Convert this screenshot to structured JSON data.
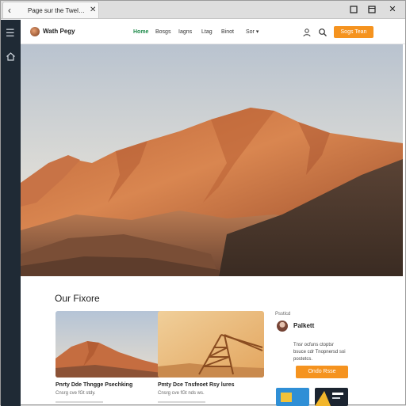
{
  "browser": {
    "tab_title": "Page sur the Twelaaon...",
    "back_icon": "back-arrow-icon",
    "close_icon": "close-icon",
    "controls": [
      "minimize-icon",
      "restore-icon",
      "close-icon"
    ]
  },
  "rail": {
    "menu_icon": "hamburger-menu-icon",
    "home_icon": "home-icon"
  },
  "header": {
    "brand": "Wath Pegy",
    "nav": [
      "Home",
      "Bosgs",
      "Iagns",
      "Ltag",
      "Binot",
      "Sor"
    ],
    "active_nav": "Home",
    "cta_label": "Sogs Tean"
  },
  "content": {
    "section_title": "Our Fixore",
    "cards": [
      {
        "title": "Pnrty Dde Thngge Psechking",
        "subtitle": "Cnsrg cve fGt stdy."
      },
      {
        "title": "Pmty Dce Tnsfeoet Rsy lures",
        "subtitle": "Cnsrg cve fGt nds ws."
      }
    ]
  },
  "sidebar": {
    "label": "Psstlcd",
    "name": "Palkett",
    "text": [
      "Tnsr ocfuns ctoptsr",
      "bsuce cdr Tnopnersd soi",
      "postetcs."
    ],
    "button_label": "Ondo Rsse"
  },
  "colors": {
    "accent": "#f5931f",
    "active_nav": "#1e8a4a",
    "rail": "#1f2a35"
  }
}
